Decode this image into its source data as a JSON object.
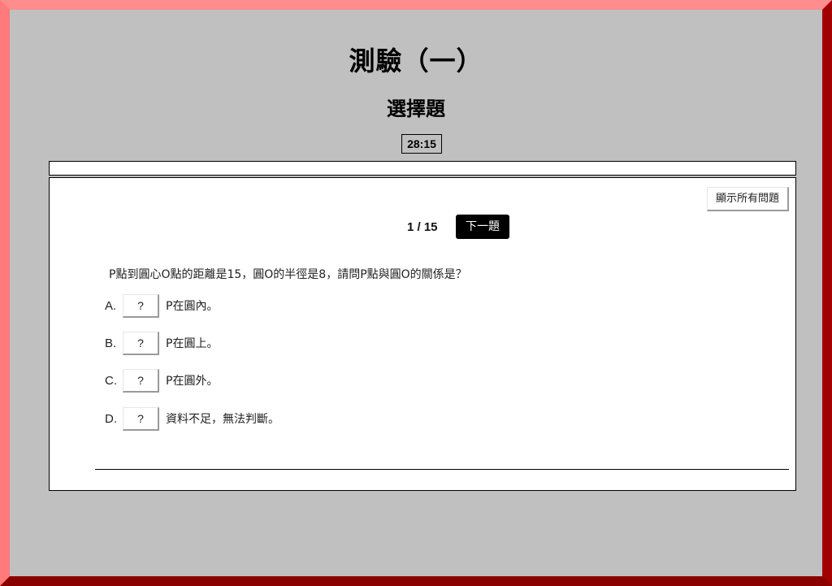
{
  "header": {
    "title": "測驗（一）",
    "subtitle": "選擇題",
    "timer": "28:15"
  },
  "progress": {
    "fraction": 0
  },
  "toolbar": {
    "show_all_label": "顯示所有問題",
    "counter": "1 / 15",
    "next_label": "下一題"
  },
  "question": {
    "text": "P點到圓心O點的距離是15，圓O的半徑是8，請問P點與圓O的關係是？",
    "options": [
      {
        "letter": "A.",
        "answer": "?",
        "text": "P在圓內。"
      },
      {
        "letter": "B.",
        "answer": "?",
        "text": "P在圓上。"
      },
      {
        "letter": "C.",
        "answer": "?",
        "text": "P在圓外。"
      },
      {
        "letter": "D.",
        "answer": "?",
        "text": "資料不足，無法判斷。"
      }
    ]
  },
  "colors": {
    "background": "#c0c0c0",
    "frame_light": "#ff8d8d",
    "frame_dark": "#a30000",
    "next_button": "#000000"
  }
}
